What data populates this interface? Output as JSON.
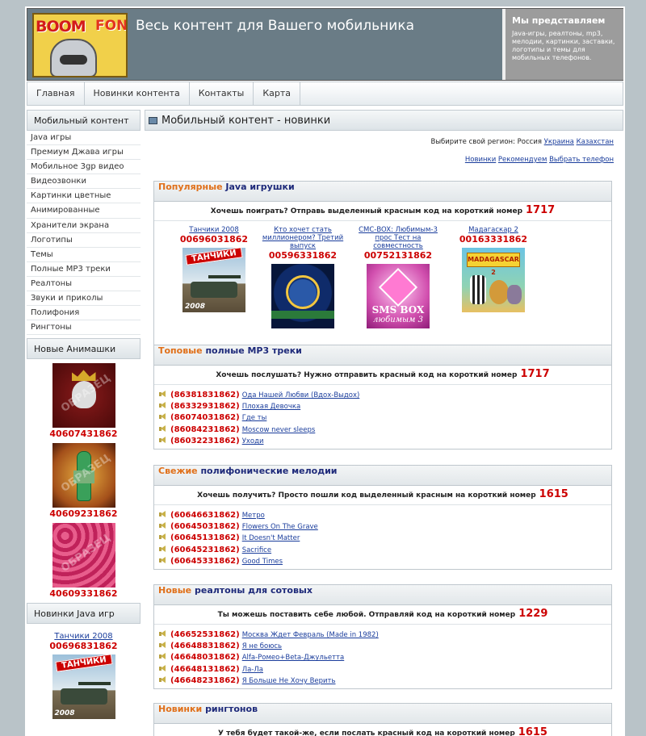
{
  "header": {
    "logo_text_1": "BOOM",
    "logo_text_2": "FON",
    "site_title": "Весь контент для Вашего мобильника",
    "promo_title": "Мы представляем",
    "promo_text": "Java-игры, реалтоны, mp3, мелодии, картинки, заставки, логотипы и темы для мобильных телефонов."
  },
  "nav": [
    "Главная",
    "Новинки контента",
    "Контакты",
    "Карта"
  ],
  "sidebar": {
    "menu_title": "Мобильный контент",
    "menu": [
      "Java игры",
      "Премиум Джава игры",
      "Мобильное 3gp видео",
      "Видеозвонки",
      "Картинки цветные",
      "Анимированные",
      "Хранители экрана",
      "Логотипы",
      "Темы",
      "Полные MP3 треки",
      "Реалтоны",
      "Звуки и приколы",
      "Полифония",
      "Рингтоны"
    ],
    "anim_title": "Новые Анимашки",
    "anim_codes": [
      "40607431862",
      "40609231862",
      "40609331862"
    ],
    "anim_watermark": "ОБРАЗЕЦ",
    "java_title": "Новинки Java игр",
    "java_game": {
      "name": "Танчики 2008",
      "code": "00696831862"
    }
  },
  "main": {
    "title": "Мобильный контент - новинки",
    "region_label": "Выбирите свой регион: Россия",
    "regions": [
      "Украина",
      "Казахстан"
    ],
    "links": [
      "Новинки",
      "Рекомендуем",
      "Выбрать телефон"
    ],
    "java": {
      "w1": "Популярные",
      "w2": "Java игрушки",
      "call": "Хочешь поиграть? Отправь выделенный красным код на короткий номер",
      "number": "1717",
      "games": [
        {
          "name": "Танчики 2008",
          "code": "00696031862",
          "pic_label": "ТАНЧИКИ",
          "pic_year": "2008"
        },
        {
          "name": "Кто хочет стать миллионером? Третий выпуск",
          "code": "00596331862"
        },
        {
          "name": "СМС-BOX: Любимым-3 прос Тест на совместность",
          "code": "00752131862",
          "pic_label": "SMS BOX",
          "pic_sub": "любимым 3"
        },
        {
          "name": "Мадагаскар 2",
          "code": "00163331862",
          "pic_label": "MADAGASCAR 2"
        }
      ]
    },
    "mp3": {
      "w1": "Топовые",
      "w2": "полные MP3 треки",
      "call": "Хочешь послушать? Нужно отправить красный код на короткий номер",
      "number": "1717",
      "tracks": [
        {
          "code": "(86381831862)",
          "title": "Ода Нашей Любви (Вдох-Выдох)"
        },
        {
          "code": "(86332931862)",
          "title": "Плохая Девочка"
        },
        {
          "code": "(86074031862)",
          "title": "Где ты"
        },
        {
          "code": "(86084231862)",
          "title": "Moscow never sleeps"
        },
        {
          "code": "(86032231862)",
          "title": "Уходи"
        }
      ]
    },
    "poly": {
      "w1": "Свежие",
      "w2": "полифонические мелодии",
      "call": "Хочешь получить? Просто пошли код выделенный красным на короткий номер",
      "number": "1615",
      "tracks": [
        {
          "code": "(60646631862)",
          "title": "Метро"
        },
        {
          "code": "(60645031862)",
          "title": "Flowers On The Grave"
        },
        {
          "code": "(60645131862)",
          "title": "It Doesn't Matter"
        },
        {
          "code": "(60645231862)",
          "title": "Sacrifice"
        },
        {
          "code": "(60645331862)",
          "title": "Good Times"
        }
      ]
    },
    "real": {
      "w1": "Новые",
      "w2": "реалтоны для сотовых",
      "call": "Ты можешь поставить себе любой. Отправляй код на короткий номер",
      "number": "1229",
      "tracks": [
        {
          "code": "(46652531862)",
          "title": "Москва Ждет Февраль (Made in 1982)"
        },
        {
          "code": "(46648831862)",
          "title": "Я не боюсь"
        },
        {
          "code": "(46648031862)",
          "title": "Alfa-Ромео+Beta-Джульетта"
        },
        {
          "code": "(46648131862)",
          "title": "Ла-Ла"
        },
        {
          "code": "(46648231862)",
          "title": "Я Больше Не Хочу Верить"
        }
      ]
    },
    "ring": {
      "w1": "Новинки",
      "w2": "рингтонов",
      "call": "У тебя будет такой-же, если послать красный код на короткий номер",
      "number": "1615"
    }
  }
}
